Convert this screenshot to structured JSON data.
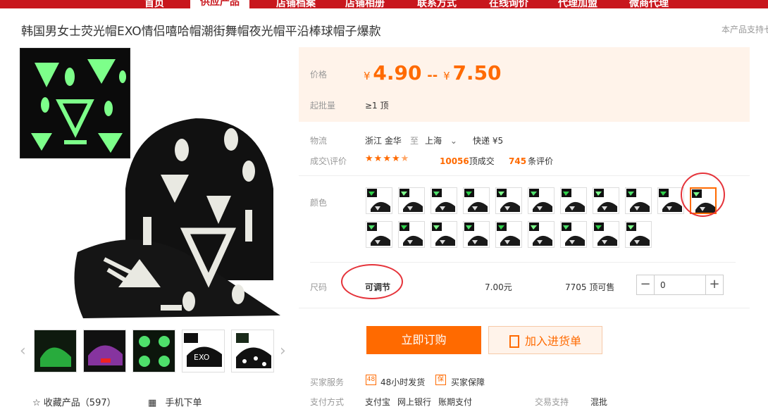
{
  "nav": {
    "items": [
      "首页",
      "供应产品",
      "店铺档案",
      "店铺相册",
      "联系方式",
      "在线询价",
      "代理加盟",
      "微商代理"
    ]
  },
  "product": {
    "title": "韩国男女士荧光帽EXO情侣嘻哈帽潮街舞帽夜光帽平沿棒球帽子爆款",
    "support_note": "本产品支持七"
  },
  "price": {
    "label": "价格",
    "currency": "¥",
    "low": "4.90",
    "sep": "--",
    "high": "7.50",
    "moq_label": "起批量",
    "moq_value": "≥1 顶"
  },
  "logistics": {
    "label": "物流",
    "from": "浙江 金华",
    "to_word": "至",
    "to": "上海",
    "shipping": "快递 ¥5"
  },
  "deals": {
    "label": "成交\\评价",
    "rating": 4.5,
    "deal_count": "10056",
    "deal_unit": "顶成交",
    "review_count": "745",
    "review_unit": "条评价"
  },
  "colors": {
    "label": "颜色",
    "selected_index": 10
  },
  "size": {
    "label": "尺码",
    "name": "可调节",
    "price": "7.00元",
    "stock": "7705 顶可售",
    "qty": "0"
  },
  "actions": {
    "buy": "立即订购",
    "cart": "加入进货单"
  },
  "services": {
    "label": "买家服务",
    "s1": "48小时发货",
    "s2": "买家保障",
    "s1_icon": "48",
    "s2_icon": "保"
  },
  "payment": {
    "label": "支付方式",
    "methods": [
      "支付宝",
      "网上银行",
      "账期支付"
    ],
    "trade_label": "交易支持",
    "trade_value": "混批"
  },
  "footer": {
    "fav": "收藏产品（597）",
    "mobile": "手机下单"
  },
  "gallery": {
    "inset_text": "EXO"
  }
}
